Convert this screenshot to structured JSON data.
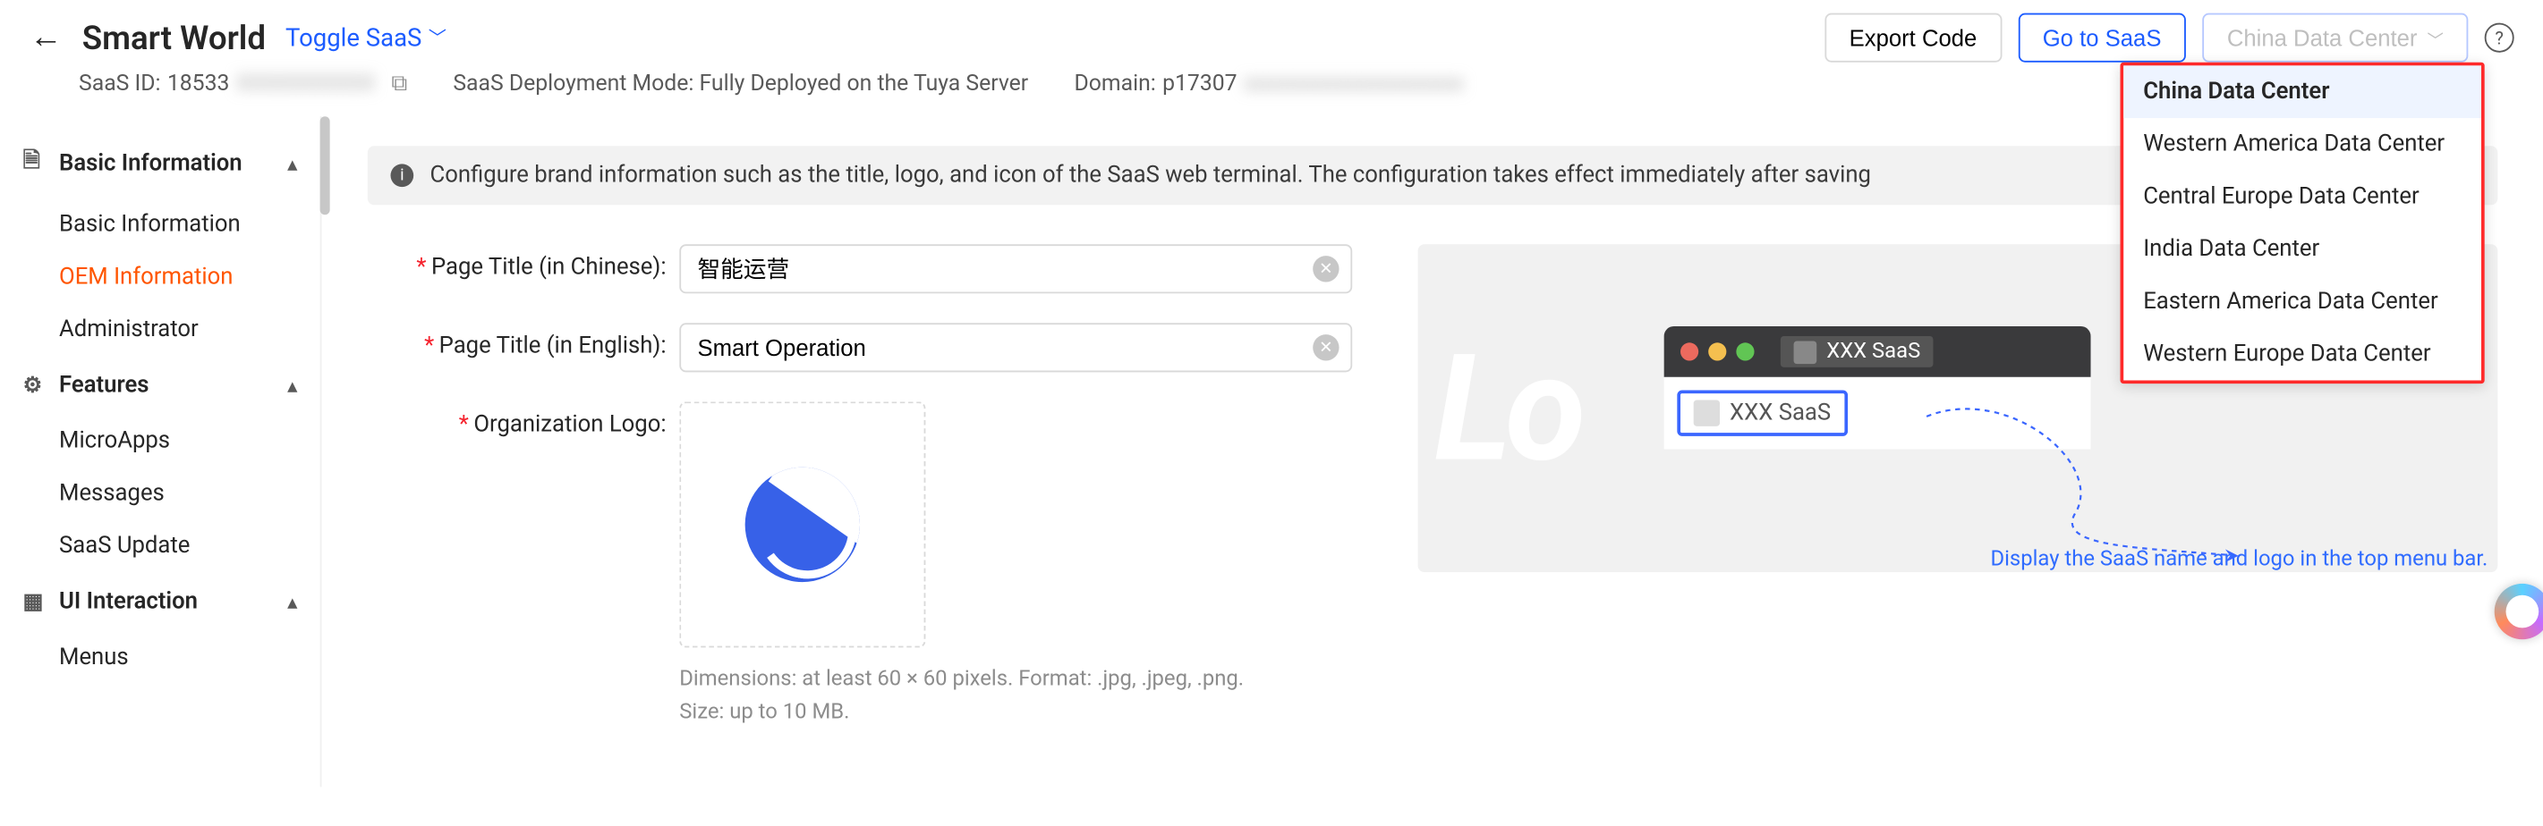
{
  "header": {
    "title": "Smart World",
    "toggle_label": "Toggle SaaS",
    "export_label": "Export Code",
    "goto_label": "Go to SaaS",
    "dc_selected": "China Data Center"
  },
  "meta": {
    "saas_id_label": "SaaS ID:",
    "saas_id_value_prefix": "18533",
    "deploy_label": "SaaS Deployment Mode: Fully Deployed on the Tuya Server",
    "domain_label": "Domain:",
    "domain_value_prefix": "p17307"
  },
  "sidebar": {
    "groups": [
      {
        "icon": "file",
        "label": "Basic Information",
        "items": [
          {
            "label": "Basic Information",
            "active": false
          },
          {
            "label": "OEM Information",
            "active": true
          },
          {
            "label": "Administrator",
            "active": false
          }
        ]
      },
      {
        "icon": "gear",
        "label": "Features",
        "items": [
          {
            "label": "MicroApps"
          },
          {
            "label": "Messages"
          },
          {
            "label": "SaaS Update"
          }
        ]
      },
      {
        "icon": "layout",
        "label": "UI Interaction",
        "items": [
          {
            "label": "Menus"
          }
        ]
      }
    ]
  },
  "banner": "Configure brand information such as the title, logo, and icon of the SaaS web terminal. The configuration takes effect immediately after saving",
  "form": {
    "title_cn_label": "Page Title (in Chinese):",
    "title_cn_value": "智能运营",
    "title_en_label": "Page Title (in English):",
    "title_en_value": "Smart Operation",
    "logo_label": "Organization Logo:",
    "logo_hint_1": "Dimensions: at least 60 × 60 pixels. Format: .jpg, .jpeg, .png.",
    "logo_hint_2": "Size: up to 10 MB."
  },
  "preview": {
    "tab_text": "XXX SaaS",
    "chip_text": "XXX SaaS",
    "caption": "Display the SaaS name and logo in the top menu bar."
  },
  "dropdown": {
    "items": [
      "China Data Center",
      "Western America Data Center",
      "Central Europe Data Center",
      "India Data Center",
      "Eastern America Data Center",
      "Western Europe Data Center"
    ],
    "selected_index": 0
  }
}
